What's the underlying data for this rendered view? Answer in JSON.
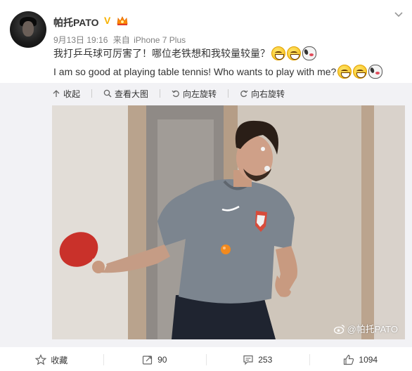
{
  "post": {
    "username": "帕托PATO",
    "verified_mark": "V",
    "date": "9月13日 19:16",
    "source_prefix": "来自",
    "source_device": "iPhone 7 Plus",
    "text_zh": "我打乒乓球可厉害了！哪位老铁想和我较量较量？",
    "text_en": "I am so good at playing table tennis! Who wants to play with me?",
    "emojis": [
      "grin-emoji",
      "grin-emoji",
      "dog-emoji"
    ]
  },
  "media_toolbar": {
    "collapse_label": "收起",
    "view_large_label": "查看大图",
    "rotate_left_label": "向左旋转",
    "rotate_right_label": "向右旋转"
  },
  "photo": {
    "watermark": "@帕托PATO"
  },
  "actions": {
    "favorite_label": "收藏",
    "repost_count": "90",
    "comment_count": "253",
    "like_count": "1094"
  },
  "colors": {
    "verified": "#f7b100",
    "meta": "#808080",
    "media_bg": "#f2f2f5",
    "text": "#333333"
  }
}
